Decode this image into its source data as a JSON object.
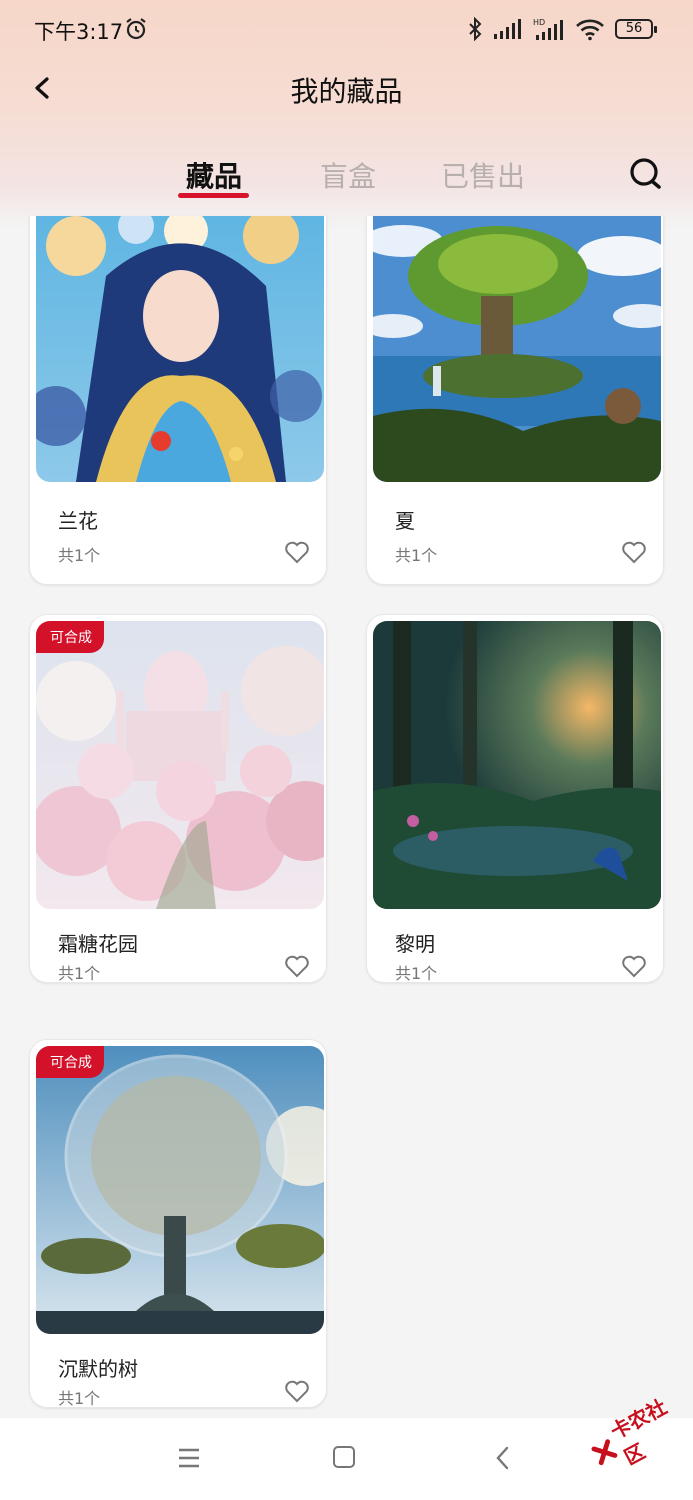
{
  "status_bar": {
    "time": "下午3:17",
    "battery": "56"
  },
  "header": {
    "title": "我的藏品"
  },
  "tabs": [
    {
      "label": "藏品",
      "active": true
    },
    {
      "label": "盲盒",
      "active": false
    },
    {
      "label": "已售出",
      "active": false
    }
  ],
  "colors": {
    "accent": "#d7142b",
    "tab_inactive": "#b7b0ad"
  },
  "items": [
    {
      "name": "兰花",
      "count": "共1个",
      "badge": ""
    },
    {
      "name": "夏",
      "count": "共1个",
      "badge": ""
    },
    {
      "name": "霜糖花园",
      "count": "共1个",
      "badge": "可合成"
    },
    {
      "name": "黎明",
      "count": "共1个",
      "badge": ""
    },
    {
      "name": "沉默的树",
      "count": "共1个",
      "badge": "可合成"
    }
  ],
  "watermark": {
    "text": "卡农社区"
  },
  "icons": [
    "alarm-icon",
    "bluetooth-icon",
    "signal-icon",
    "wifi-icon",
    "battery-icon",
    "back-arrow-icon",
    "search-icon",
    "heart-icon",
    "menu-icon",
    "home-icon",
    "nav-back-icon"
  ]
}
